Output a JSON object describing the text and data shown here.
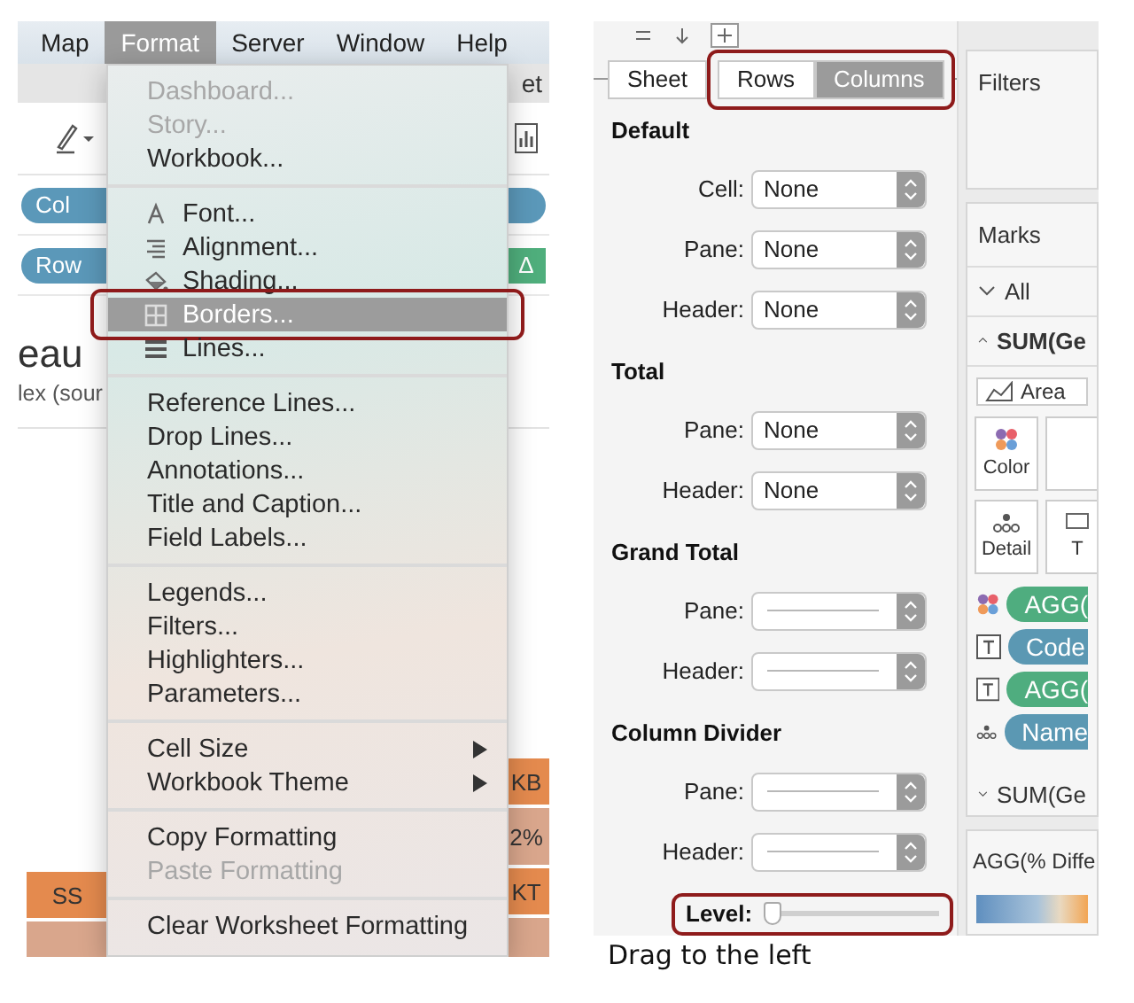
{
  "left": {
    "menubar": [
      {
        "label": "Map",
        "selected": false
      },
      {
        "label": "Format",
        "selected": true
      },
      {
        "label": "Server",
        "selected": false
      },
      {
        "label": "Window",
        "selected": false
      },
      {
        "label": "Help",
        "selected": false
      }
    ],
    "sheet_tab": "et",
    "shelves": [
      {
        "label": "Col"
      },
      {
        "label": "Row",
        "end_pill": "Δ"
      }
    ],
    "title": "eau",
    "subtitle": "lex (sour",
    "cells_left": [
      {
        "text": "SS",
        "kind": "header"
      }
    ],
    "cells_right": [
      {
        "text": "KB",
        "kind": "header"
      },
      {
        "text": "2%",
        "kind": "value"
      },
      {
        "text": "KT",
        "kind": "header"
      }
    ],
    "menu": [
      [
        {
          "label": "Dashboard...",
          "disabled": true,
          "selected": false
        },
        {
          "label": "Story...",
          "disabled": true,
          "selected": false
        },
        {
          "label": "Workbook...",
          "disabled": false,
          "selected": false
        }
      ],
      [
        {
          "label": "Font...",
          "disabled": false,
          "selected": false,
          "kind": "font"
        },
        {
          "label": "Alignment...",
          "disabled": false,
          "selected": false,
          "kind": "alignment"
        },
        {
          "label": "Shading...",
          "disabled": false,
          "selected": false,
          "kind": "shading"
        },
        {
          "label": "Borders...",
          "disabled": false,
          "selected": true,
          "kind": "borders"
        },
        {
          "label": "Lines...",
          "disabled": false,
          "selected": false,
          "kind": "lines"
        }
      ],
      [
        {
          "label": "Reference Lines...",
          "disabled": false,
          "selected": false
        },
        {
          "label": "Drop Lines...",
          "disabled": false,
          "selected": false
        },
        {
          "label": "Annotations...",
          "disabled": false,
          "selected": false
        },
        {
          "label": "Title and Caption...",
          "disabled": false,
          "selected": false
        },
        {
          "label": "Field Labels...",
          "disabled": false,
          "selected": false
        }
      ],
      [
        {
          "label": "Legends...",
          "disabled": false,
          "selected": false
        },
        {
          "label": "Filters...",
          "disabled": false,
          "selected": false
        },
        {
          "label": "Highlighters...",
          "disabled": false,
          "selected": false
        },
        {
          "label": "Parameters...",
          "disabled": false,
          "selected": false
        }
      ],
      [
        {
          "label": "Cell Size",
          "disabled": false,
          "selected": false,
          "submenu": true
        },
        {
          "label": "Workbook Theme",
          "disabled": false,
          "selected": false,
          "submenu": true
        }
      ],
      [
        {
          "label": "Copy Formatting",
          "disabled": false,
          "selected": false
        },
        {
          "label": "Paste Formatting",
          "disabled": true,
          "selected": false
        }
      ],
      [
        {
          "label": "Clear Worksheet Formatting",
          "disabled": false,
          "selected": false
        }
      ]
    ]
  },
  "right": {
    "tabs": [
      {
        "label": "Sheet",
        "selected": false,
        "outlined": false
      },
      {
        "label": "Rows",
        "selected": false,
        "outlined": true
      },
      {
        "label": "Columns",
        "selected": true,
        "outlined": true
      }
    ],
    "sections": [
      {
        "title": "Default",
        "fields": [
          {
            "label": "Cell:",
            "kind": "text",
            "value": "None"
          },
          {
            "label": "Pane:",
            "kind": "text",
            "value": "None"
          },
          {
            "label": "Header:",
            "kind": "text",
            "value": "None"
          }
        ]
      },
      {
        "title": "Total",
        "fields": [
          {
            "label": "Pane:",
            "kind": "text",
            "value": "None"
          },
          {
            "label": "Header:",
            "kind": "text",
            "value": "None"
          }
        ]
      },
      {
        "title": "Grand Total",
        "fields": [
          {
            "label": "Pane:",
            "kind": "line"
          },
          {
            "label": "Header:",
            "kind": "line"
          }
        ]
      },
      {
        "title": "Column Divider",
        "fields": [
          {
            "label": "Pane:",
            "kind": "line"
          },
          {
            "label": "Header:",
            "kind": "line"
          }
        ]
      }
    ],
    "level_slider": {
      "label": "Level:",
      "level": 0,
      "outlined": true
    },
    "filters_title": "Filters",
    "marks": {
      "title": "Marks",
      "all": "All",
      "measure": "SUM(Ge",
      "mark_type": "Area",
      "buttons": [
        {
          "label": "Color",
          "kind": "color"
        },
        {
          "kind": "size"
        },
        {
          "label": "Detail",
          "kind": "detail"
        },
        {
          "label": "T",
          "kind": "tooltip"
        }
      ],
      "pills": [
        {
          "label": "AGG(",
          "kind": "color",
          "color": "#4fad7f"
        },
        {
          "label": "Code",
          "kind": "text",
          "color": "#5b98b3"
        },
        {
          "label": "AGG(",
          "kind": "text",
          "color": "#4fad7f"
        },
        {
          "label": "Name",
          "kind": "detail",
          "color": "#5b98b3"
        }
      ],
      "collapsed": "SUM(Ge"
    },
    "legend_title": "AGG(% Diffe"
  },
  "caption": "Drag to the left"
}
